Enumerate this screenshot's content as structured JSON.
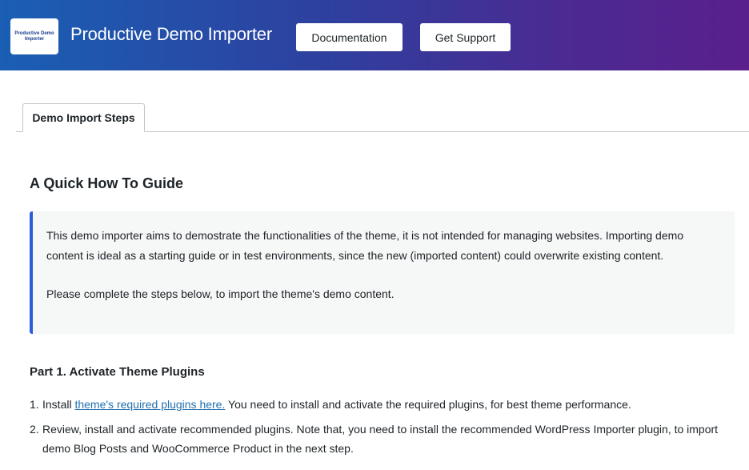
{
  "header": {
    "logo_text": "Productive Demo Importer",
    "title": "Productive Demo Importer",
    "documentation_label": "Documentation",
    "support_label": "Get Support"
  },
  "tabs": [
    {
      "label": "Demo Import Steps",
      "active": true
    }
  ],
  "guide": {
    "title": "A Quick How To Guide",
    "notice_paragraph_1": "This demo importer aims to demostrate the functionalities of the theme, it is not intended for managing websites. Importing demo content is ideal as a starting guide or in test environments, since the new (imported content) could overwrite existing content.",
    "notice_paragraph_2": "Please complete the steps below, to import the theme's demo content."
  },
  "part1": {
    "title": "Part 1. Activate Theme Plugins",
    "steps": [
      {
        "number": "1.",
        "prefix": "Install ",
        "link_text": "theme's required plugins here.",
        "suffix": " You need to install and activate the required plugins, for best theme performance."
      },
      {
        "number": "2.",
        "text": "Review, install and activate recommended plugins. Note that, you need to install the recommended WordPress Importer plugin, to import demo Blog Posts and WooCommerce Product in the next step."
      }
    ]
  },
  "colors": {
    "header_gradient_start": "#1a5fb4",
    "header_gradient_end": "#5a1f8c",
    "notice_accent": "#2b5ddb",
    "link": "#2271b1"
  }
}
